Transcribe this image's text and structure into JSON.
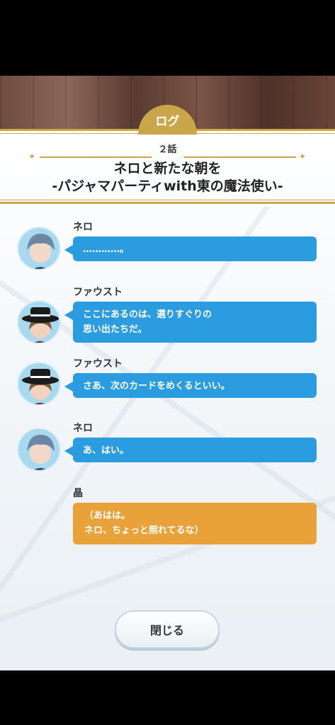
{
  "log_tab": "ログ",
  "episode": "２話",
  "title_line1": "ネロと新たな朝を",
  "title_line2": "-パジャマパーティwith東の魔法使い-",
  "entries": [
    {
      "speaker": "ネロ",
      "text": "…………。"
    },
    {
      "speaker": "ファウスト",
      "text": "ここにあるのは、選りすぐりの\n思い出たちだ。"
    },
    {
      "speaker": "ファウスト",
      "text": "さあ、次のカードをめくるといい。"
    },
    {
      "speaker": "ネロ",
      "text": "あ、はい。"
    },
    {
      "speaker": "晶",
      "text": "（あはは。\nネロ、ちょっと照れてるな）"
    }
  ],
  "close_button": "閉じる",
  "colors": {
    "gold": "#c9a64a",
    "bubble_blue": "#2b9ce0",
    "bubble_orange": "#e9a13a"
  }
}
